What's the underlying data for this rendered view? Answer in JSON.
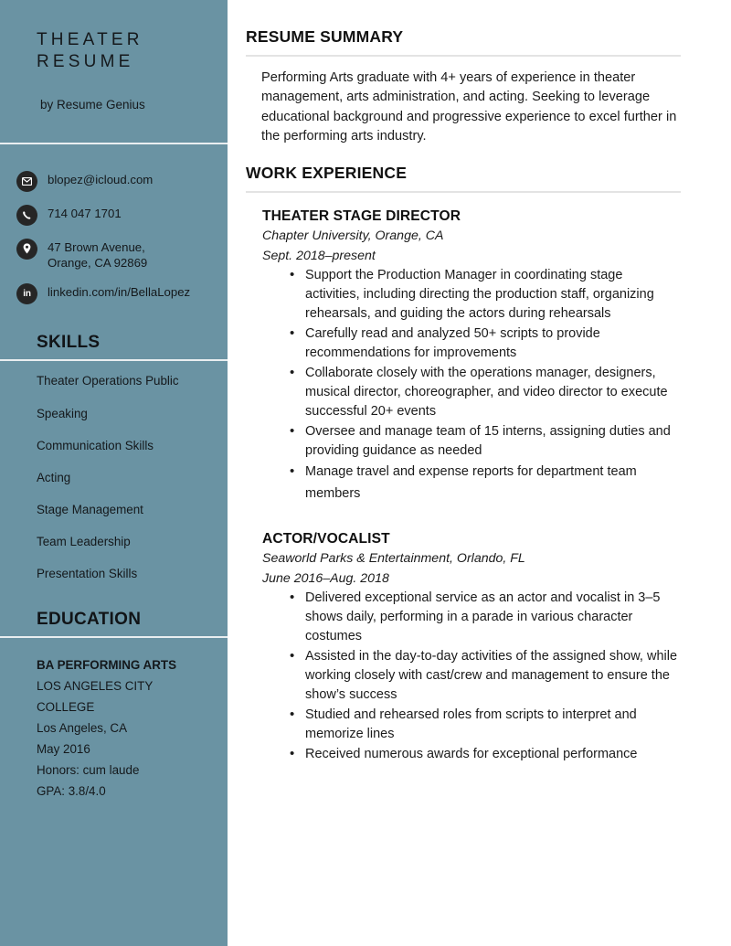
{
  "sidebar": {
    "title": "THEATER\nRESUME",
    "byline": "by Resume Genius",
    "contact": [
      {
        "icon": "envelope-icon",
        "text": "blopez@icloud.com"
      },
      {
        "icon": "phone-icon",
        "text": "714 047 1701"
      },
      {
        "icon": "location-pin-icon",
        "text": "47 Brown Avenue,\nOrange, CA 92869"
      },
      {
        "icon": "linkedin-icon",
        "text": "linkedin.com/in/BellaLopez",
        "glyph": "in"
      }
    ],
    "skills_heading": "SKILLS",
    "skills": [
      "Theater Operations Public",
      "Speaking",
      "Communication Skills",
      "Acting",
      "Stage Management",
      "Team Leadership",
      "Presentation Skills"
    ],
    "education_heading": "EDUCATION",
    "education": [
      "BA PERFORMING ARTS",
      "LOS ANGELES CITY COLLEGE",
      "Los Angeles, CA",
      "May 2016",
      "Honors: cum laude",
      "GPA: 3.8/4.0"
    ]
  },
  "main": {
    "summary_heading": "RESUME SUMMARY",
    "summary": "Performing Arts graduate with 4+ years of experience in theater management, arts administration, and acting. Seeking to leverage educational background and progressive experience to excel further in the performing arts industry.",
    "work_heading": "WORK EXPERIENCE",
    "jobs": [
      {
        "title": "THEATER STAGE DIRECTOR",
        "organization": "Chapter University, Orange, CA",
        "dates": "Sept. 2018–present",
        "bullets": [
          "Support the Production Manager in coordinating stage activities, including directing the production staff, organizing rehearsals, and guiding the actors during rehearsals",
          "Carefully read and analyzed 50+ scripts to provide recommendations for improvements",
          "Collaborate closely with the operations manager, designers, musical director, choreographer, and video director to execute successful 20+ events",
          "Oversee and manage team of 15 interns, assigning duties and providing guidance as needed",
          "Manage travel and expense reports for department team members"
        ]
      },
      {
        "title": "ACTOR/VOCALIST",
        "organization": "Seaworld Parks & Entertainment, Orlando, FL",
        "dates": "June 2016–Aug. 2018",
        "bullets": [
          "Delivered exceptional service as an actor and vocalist in 3–5 shows daily, performing in a parade in various character costumes",
          "Assisted in the day-to-day activities of the assigned show, while working closely with cast/crew and management to ensure the show’s success",
          "Studied and rehearsed roles from scripts to interpret and memorize lines",
          "Received numerous awards for exceptional performance"
        ]
      }
    ]
  },
  "colors": {
    "sidebar_background": "#6a93a3",
    "sidebar_rule": "#e9eef0",
    "icon_background": "#262626",
    "section_rule": "#e3e3e3",
    "text": "#1b1b1b"
  }
}
